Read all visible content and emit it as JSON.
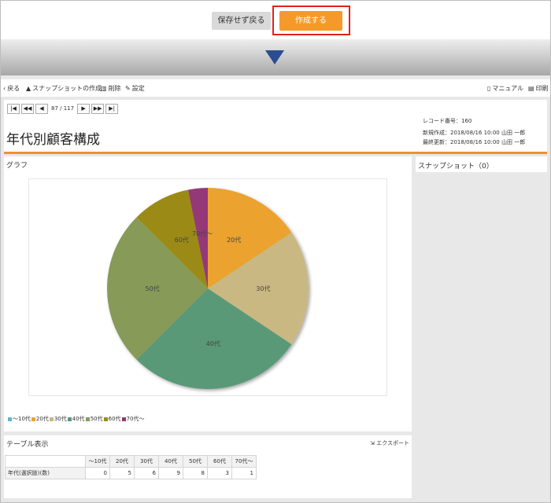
{
  "topbar": {
    "back_label": "保存せず戻る",
    "create_label": "作成する"
  },
  "toolbar": {
    "back": "戻る",
    "snapshot": "スナップショットの作成",
    "delete": "削除",
    "settings": "設定",
    "manual": "マニュアル",
    "print": "印刷"
  },
  "pager": {
    "current": "87 / 117"
  },
  "page": {
    "title": "年代別顧客構成"
  },
  "record": {
    "number": "レコード番号：160",
    "created": "新規作成：2018/08/16 10:00 山田 一郎",
    "updated": "最終更新：2018/08/16 10:00 山田 一郎"
  },
  "graph": {
    "title": "グラフ"
  },
  "snapshot_panel": {
    "title": "スナップショット（0）"
  },
  "table": {
    "title": "テーブル表示",
    "export": "エクスポート",
    "row_label": "年代(選択肢)(数)"
  },
  "colors": {
    "accent": "#f59a2a",
    "highlight": "#e02020",
    "divider": "#f0902f"
  },
  "chart_data": {
    "type": "pie",
    "categories": [
      "〜10代",
      "20代",
      "30代",
      "40代",
      "50代",
      "60代",
      "70代〜"
    ],
    "values": [
      0,
      5,
      6,
      9,
      8,
      3,
      1
    ],
    "colors": [
      "#5cb8c8",
      "#eba22e",
      "#c9b882",
      "#5a9977",
      "#879a59",
      "#9b8b12",
      "#953778"
    ],
    "legend": "bottom-left"
  }
}
